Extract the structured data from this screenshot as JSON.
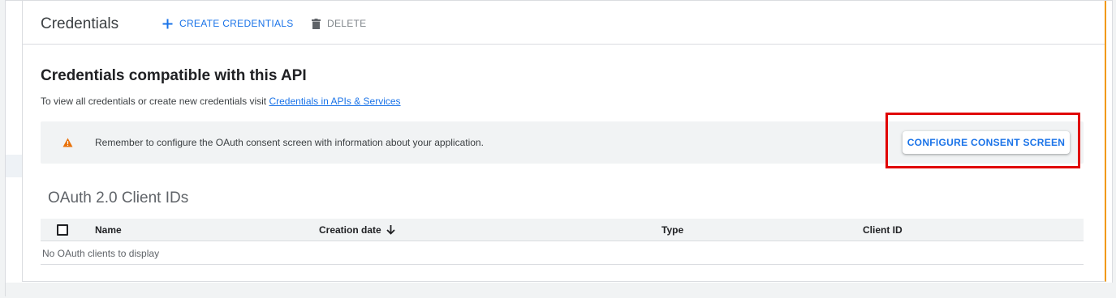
{
  "toolbar": {
    "title": "Credentials",
    "create_label": "CREATE CREDENTIALS",
    "delete_label": "DELETE"
  },
  "section": {
    "heading": "Credentials compatible with this API",
    "subtext_prefix": "To view all credentials or create new credentials visit ",
    "subtext_link": "Credentials in APIs & Services"
  },
  "banner": {
    "message": "Remember to configure the OAuth consent screen with information about your application.",
    "button_label": "CONFIGURE CONSENT SCREEN"
  },
  "oauth": {
    "heading": "OAuth 2.0 Client IDs",
    "columns": [
      "Name",
      "Creation date",
      "Type",
      "Client ID"
    ],
    "empty_message": "No OAuth clients to display"
  },
  "colors": {
    "accent": "#1a73e8",
    "warning": "#e8710a",
    "highlight": "#e00000"
  },
  "icons": {
    "create": "plus-icon",
    "delete": "trash-icon",
    "warning": "warning-triangle-icon",
    "sort": "arrow-down-icon"
  }
}
